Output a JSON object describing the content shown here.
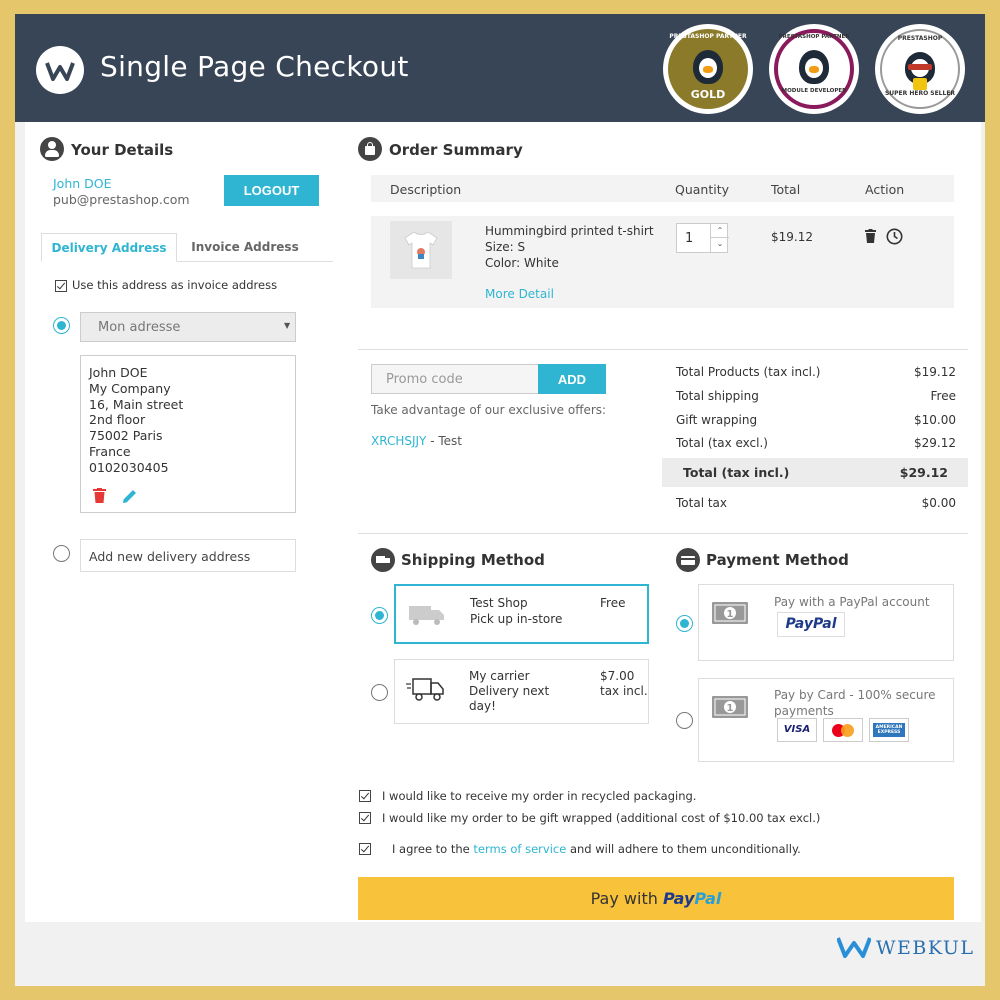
{
  "header": {
    "title": "Single Page Checkout",
    "badges": [
      {
        "top": "PRESTASHOP PARTNER",
        "label": "GOLD"
      },
      {
        "top": "PRESTASHOP PARTNER",
        "label": "MODULE DEVELOPER"
      },
      {
        "top": "PRESTASHOP",
        "label": "SUPER HERO SELLER"
      }
    ]
  },
  "details": {
    "title": "Your Details",
    "name": "John DOE",
    "email": "pub@prestashop.com",
    "logout": "LOGOUT",
    "tabs": [
      "Delivery Address",
      "Invoice Address"
    ],
    "same_invoice": "Use this address as invoice address",
    "address_select": "Mon adresse",
    "address_lines": [
      "John DOE",
      "My Company",
      "16, Main street",
      "2nd floor",
      "75002 Paris",
      "France",
      "0102030405"
    ],
    "add_new": "Add new delivery address"
  },
  "summary": {
    "title": "Order Summary",
    "columns": [
      "Description",
      "Quantity",
      "Total",
      "Action"
    ],
    "item": {
      "name": "Hummingbird printed t-shirt",
      "size": "Size: S",
      "color": "Color: White",
      "more": "More Detail",
      "qty": "1",
      "total": "$19.12"
    },
    "promo_placeholder": "Promo code",
    "promo_button": "ADD",
    "offers_text": "Take advantage of our exclusive offers:",
    "offer_code": "XRCHSJJY",
    "offer_name": " - Test",
    "totals": [
      {
        "label": "Total Products  (tax incl.)",
        "value": "$19.12"
      },
      {
        "label": "Total shipping",
        "value": "Free"
      },
      {
        "label": "Gift wrapping",
        "value": "$10.00"
      },
      {
        "label": "Total (tax excl.)",
        "value": "$29.12"
      }
    ],
    "grand": {
      "label": "Total (tax incl.)",
      "value": "$29.12"
    },
    "tax": {
      "label": "Total tax",
      "value": "$0.00"
    }
  },
  "shipping": {
    "title": "Shipping Method",
    "options": [
      {
        "name": "Test Shop",
        "desc": "Pick up in-store",
        "price": "Free"
      },
      {
        "name": "My carrier",
        "desc": "Delivery next day!",
        "price": "$7.00 tax incl."
      }
    ]
  },
  "payment": {
    "title": "Payment Method",
    "options": [
      {
        "label": "Pay with a PayPal account",
        "logo": "PayPal"
      },
      {
        "label": "Pay by Card - 100% secure payments",
        "cards": [
          "VISA",
          "",
          "AMERICAN EXPRESS"
        ]
      }
    ]
  },
  "checks": {
    "recycled": "I would like to receive my order in recycled packaging.",
    "gift": "I would like my order to be gift wrapped (additional cost of $10.00 tax excl.)",
    "terms_pre": "I agree to the ",
    "terms_link": "terms of service",
    "terms_post": " and will adhere to them unconditionally."
  },
  "pay_button": {
    "pre": "Pay with ",
    "brand1": "Pay",
    "brand2": "Pal"
  },
  "footer": {
    "brand": "WEBKUL"
  },
  "colors": {
    "accent": "#2fb5d2",
    "header": "#384556",
    "frame": "#e6c66a",
    "paypal_btn": "#f8c33a"
  }
}
